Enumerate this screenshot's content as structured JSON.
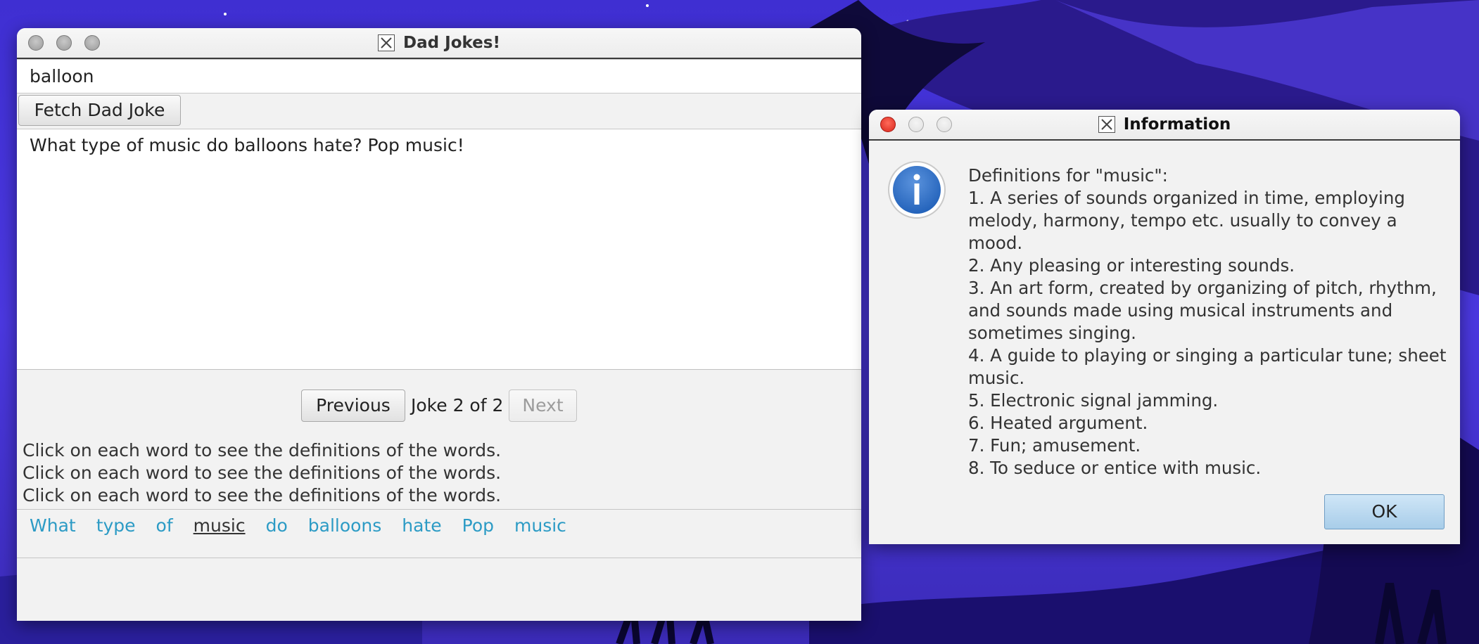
{
  "colors": {
    "desktop_bg": "#4a36d6",
    "link_word": "#2c9bc5",
    "active_word": "#333333",
    "ok_button": "#b5d6ee",
    "close_red": "#e0291c"
  },
  "jokes_window": {
    "title": "Dad Jokes!",
    "title_icon": "x11-icon",
    "search_value": "balloon",
    "fetch_label": "Fetch Dad Joke",
    "joke_text": "What type of music do balloons hate? Pop music!",
    "prev_label": "Previous",
    "counter_text": "Joke 2 of 2",
    "next_label": "Next",
    "hints": [
      "Click on each word to see the definitions of the words.",
      "Click on each word to see the definitions of the words.",
      "Click on each word to see the definitions of the words."
    ],
    "words": [
      {
        "text": "What",
        "active": false
      },
      {
        "text": "type",
        "active": false
      },
      {
        "text": "of",
        "active": false
      },
      {
        "text": "music",
        "active": true
      },
      {
        "text": "do",
        "active": false
      },
      {
        "text": "balloons",
        "active": false
      },
      {
        "text": "hate",
        "active": false
      },
      {
        "text": "Pop",
        "active": false
      },
      {
        "text": "music",
        "active": false
      }
    ]
  },
  "info_window": {
    "title": "Information",
    "title_icon": "x11-icon",
    "icon": "info-icon",
    "heading": "Definitions for \"music\":",
    "definitions": [
      "1. A series of sounds organized in time, employing melody, harmony, tempo etc. usually to convey a mood.",
      "2. Any pleasing or interesting sounds.",
      "3. An art form, created by organizing of pitch, rhythm, and sounds made using musical instruments and sometimes singing.",
      "4. A guide to playing or singing a particular tune; sheet music.",
      "5. Electronic signal jamming.",
      "6. Heated argument.",
      "7. Fun; amusement.",
      "8. To seduce or entice with music."
    ],
    "ok_label": "OK"
  }
}
